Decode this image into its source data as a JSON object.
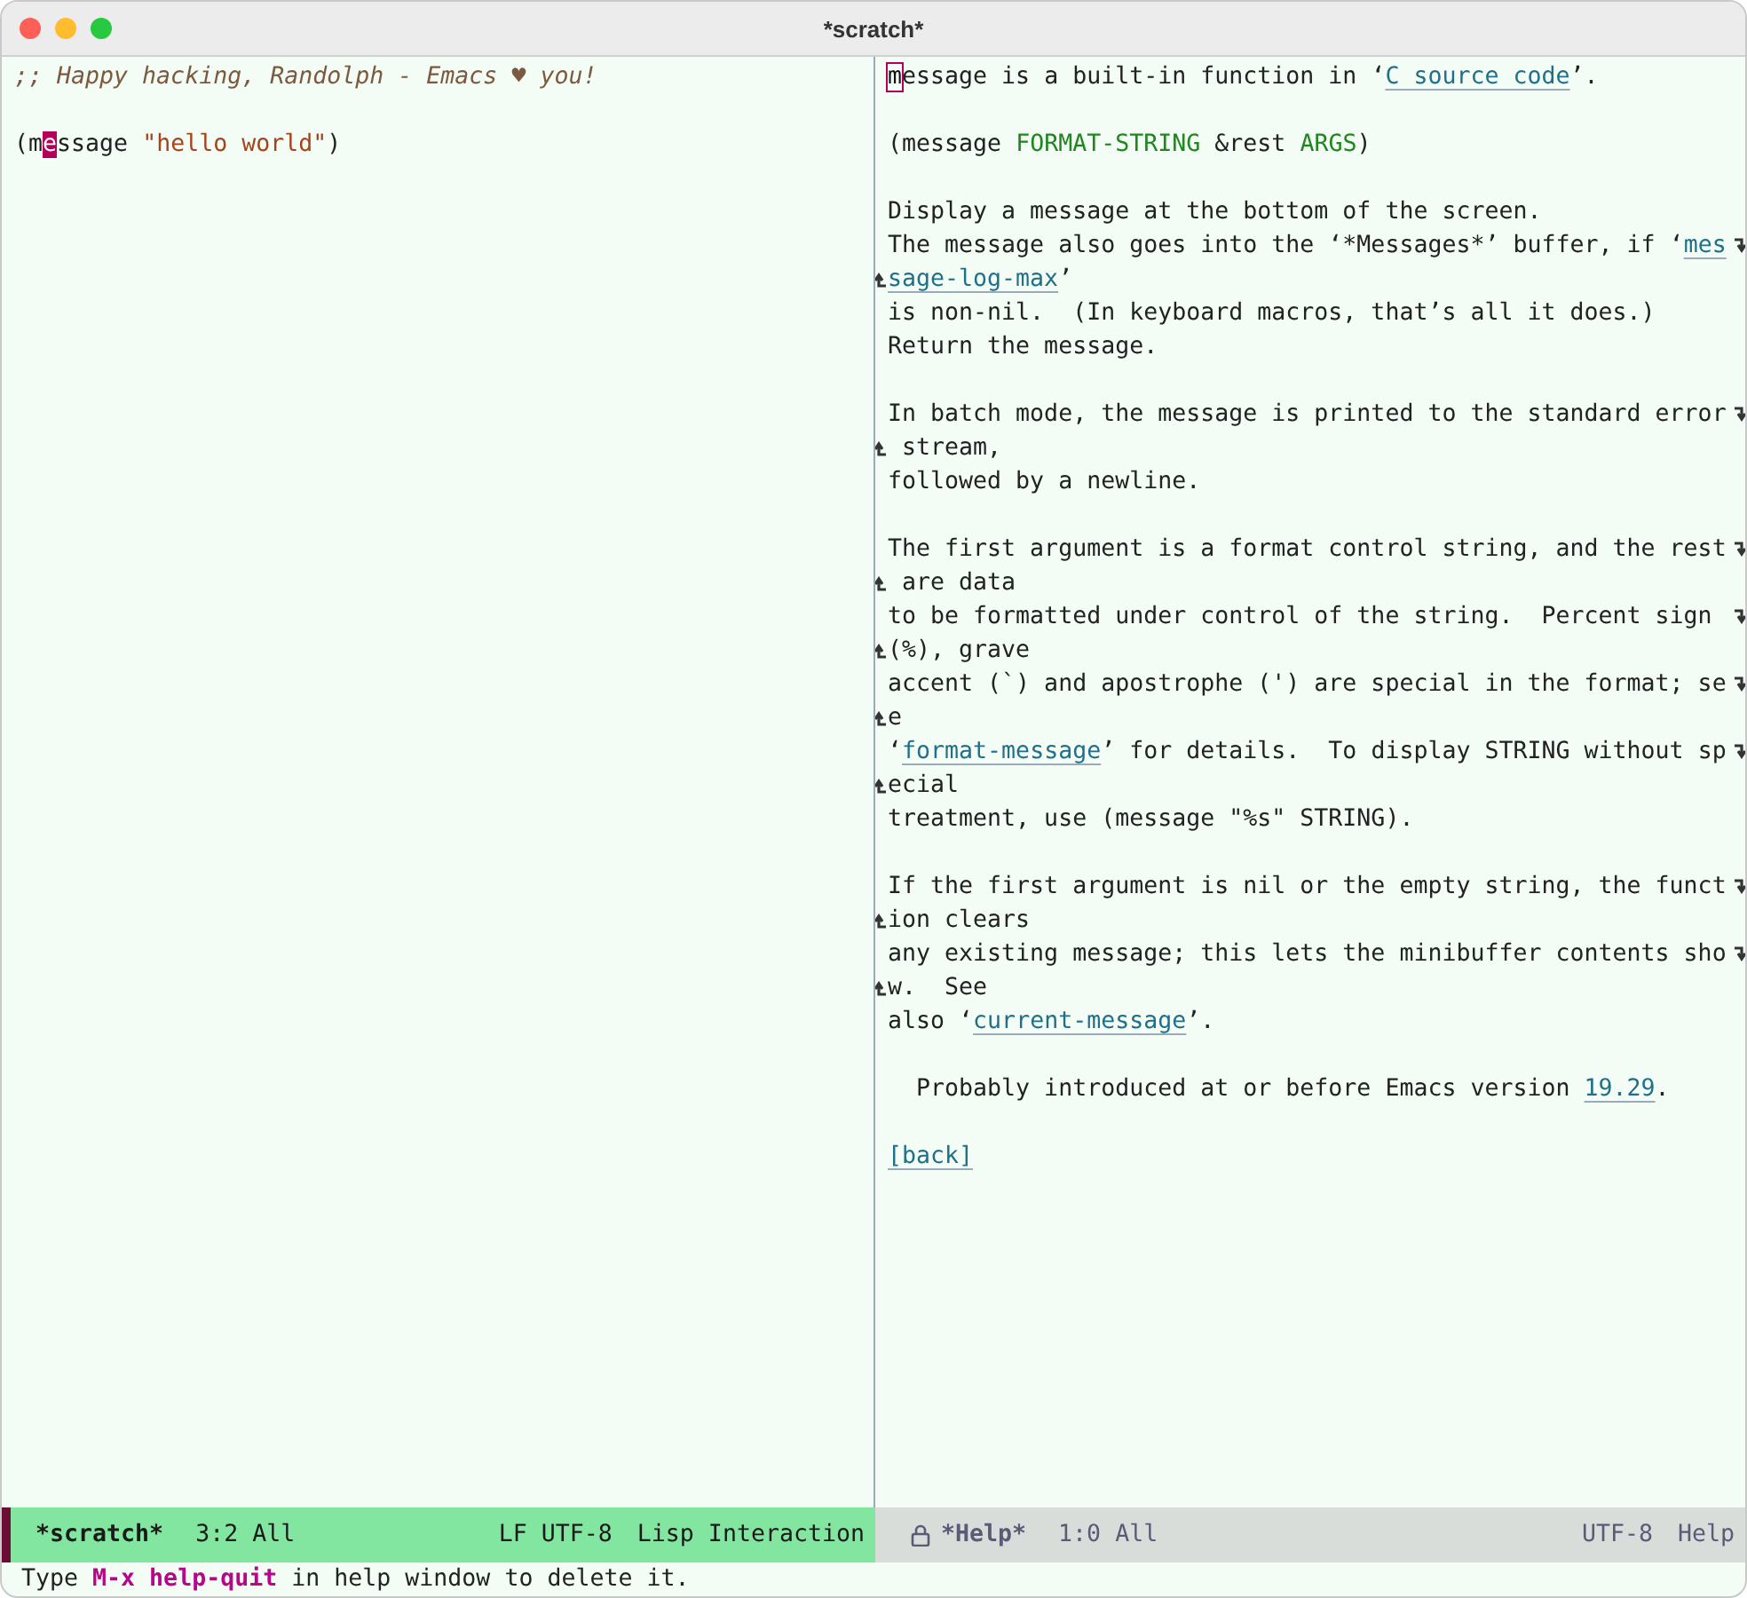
{
  "window": {
    "title": "*scratch*"
  },
  "scratch": {
    "paragraphs": [
      {
        "lines": [
          {
            "segments": [
              {
                "kind": "comment",
                "text": ";; Happy hacking, Randolph - Emacs ♥ you!"
              }
            ]
          }
        ]
      },
      {
        "lines": [
          {
            "segments": [
              {
                "kind": "text",
                "text": "(m"
              },
              {
                "kind": "cursor",
                "text": "e"
              },
              {
                "kind": "text",
                "text": "ssage "
              },
              {
                "kind": "string",
                "text": "\"hello world\""
              },
              {
                "kind": "text",
                "text": ")"
              }
            ]
          }
        ]
      }
    ]
  },
  "help": {
    "paragraphs": [
      {
        "lines": [
          {
            "continued": false,
            "segments": [
              {
                "kind": "cursor",
                "text": "m"
              },
              {
                "kind": "text",
                "text": "essage is a built-in function in ‘"
              },
              {
                "kind": "link",
                "text": "C source code"
              },
              {
                "kind": "text",
                "text": "’."
              }
            ]
          }
        ]
      },
      {
        "lines": [
          {
            "continued": false,
            "segments": [
              {
                "kind": "text",
                "text": "(message "
              },
              {
                "kind": "arg",
                "text": "FORMAT-STRING"
              },
              {
                "kind": "text",
                "text": " &rest "
              },
              {
                "kind": "arg",
                "text": "ARGS"
              },
              {
                "kind": "text",
                "text": ")"
              }
            ]
          }
        ]
      },
      {
        "lines": [
          {
            "continued": false,
            "segments": [
              {
                "kind": "text",
                "text": "Display a message at the bottom of the screen."
              }
            ]
          },
          {
            "continued": true,
            "segments": [
              {
                "kind": "text",
                "text": "The message also goes into the ‘*Messages*’ buffer, if ‘"
              },
              {
                "kind": "link",
                "text": "mes"
              }
            ]
          },
          {
            "continued": false,
            "segments": [
              {
                "kind": "link",
                "text": "sage-log-max"
              },
              {
                "kind": "text",
                "text": "’"
              }
            ]
          },
          {
            "continued": false,
            "segments": [
              {
                "kind": "text",
                "text": "is non-nil.  (In keyboard macros, that’s all it does.)"
              }
            ]
          },
          {
            "continued": false,
            "segments": [
              {
                "kind": "text",
                "text": "Return the message."
              }
            ]
          }
        ]
      },
      {
        "lines": [
          {
            "continued": true,
            "segments": [
              {
                "kind": "text",
                "text": "In batch mode, the message is printed to the standard error"
              }
            ]
          },
          {
            "continued": false,
            "segments": [
              {
                "kind": "text",
                "text": " stream,"
              }
            ]
          },
          {
            "continued": false,
            "segments": [
              {
                "kind": "text",
                "text": "followed by a newline."
              }
            ]
          }
        ]
      },
      {
        "lines": [
          {
            "continued": true,
            "segments": [
              {
                "kind": "text",
                "text": "The first argument is a format control string, and the rest"
              }
            ]
          },
          {
            "continued": false,
            "segments": [
              {
                "kind": "text",
                "text": " are data"
              }
            ]
          },
          {
            "continued": true,
            "segments": [
              {
                "kind": "text",
                "text": "to be formatted under control of the string.  Percent sign "
              }
            ]
          },
          {
            "continued": false,
            "segments": [
              {
                "kind": "text",
                "text": "(%), grave"
              }
            ]
          },
          {
            "continued": true,
            "segments": [
              {
                "kind": "text",
                "text": "accent (`) and apostrophe (') are special in the format; se"
              }
            ]
          },
          {
            "continued": false,
            "segments": [
              {
                "kind": "text",
                "text": "e"
              }
            ]
          },
          {
            "continued": true,
            "segments": [
              {
                "kind": "text",
                "text": "‘"
              },
              {
                "kind": "link",
                "text": "format-message"
              },
              {
                "kind": "text",
                "text": "’ for details.  To display STRING without sp"
              }
            ]
          },
          {
            "continued": false,
            "segments": [
              {
                "kind": "text",
                "text": "ecial"
              }
            ]
          },
          {
            "continued": false,
            "segments": [
              {
                "kind": "text",
                "text": "treatment, use (message \"%s\" STRING)."
              }
            ]
          }
        ]
      },
      {
        "lines": [
          {
            "continued": true,
            "segments": [
              {
                "kind": "text",
                "text": "If the first argument is nil or the empty string, the funct"
              }
            ]
          },
          {
            "continued": false,
            "segments": [
              {
                "kind": "text",
                "text": "ion clears"
              }
            ]
          },
          {
            "continued": true,
            "segments": [
              {
                "kind": "text",
                "text": "any existing message; this lets the minibuffer contents sho"
              }
            ]
          },
          {
            "continued": false,
            "segments": [
              {
                "kind": "text",
                "text": "w.  See"
              }
            ]
          },
          {
            "continued": false,
            "segments": [
              {
                "kind": "text",
                "text": "also ‘"
              },
              {
                "kind": "link",
                "text": "current-message"
              },
              {
                "kind": "text",
                "text": "’."
              }
            ]
          }
        ]
      },
      {
        "lines": [
          {
            "continued": false,
            "segments": [
              {
                "kind": "text",
                "text": "  Probably introduced at or before Emacs version "
              },
              {
                "kind": "link",
                "text": "19.29"
              },
              {
                "kind": "text",
                "text": "."
              }
            ]
          }
        ]
      },
      {
        "lines": [
          {
            "continued": false,
            "segments": [
              {
                "kind": "link",
                "text": "[back]"
              }
            ]
          }
        ]
      }
    ]
  },
  "mode_lines": [
    {
      "active": true,
      "read_only": false,
      "buffer": "*scratch*",
      "position": "3:2 All",
      "encoding": "LF UTF-8",
      "mode": "Lisp Interaction"
    },
    {
      "active": false,
      "read_only": true,
      "buffer": "*Help*",
      "position": "1:0 All",
      "encoding": "UTF-8",
      "mode": "Help"
    }
  ],
  "echo_area": {
    "segments": [
      {
        "kind": "text",
        "text": "Type "
      },
      {
        "kind": "key",
        "text": "M-x help-quit"
      },
      {
        "kind": "text",
        "text": " in help window to delete it."
      }
    ]
  }
}
